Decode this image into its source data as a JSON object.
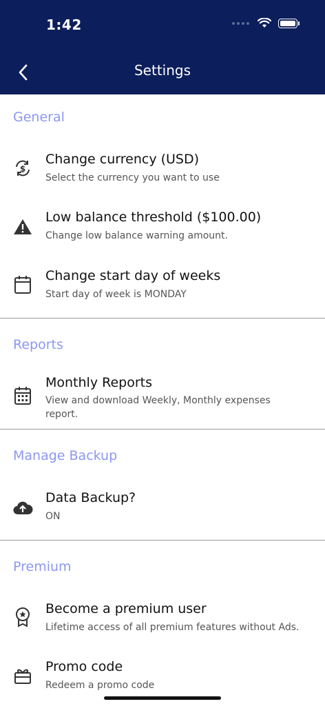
{
  "status_bar": {
    "time": "1:42"
  },
  "header": {
    "title": "Settings"
  },
  "sections": {
    "general": {
      "label": "General",
      "items": [
        {
          "title": "Change currency (USD)",
          "subtitle": "Select the currency you want to use",
          "icon": "currency-exchange-icon"
        },
        {
          "title": "Low balance threshold ($100.00)",
          "subtitle": "Change low balance warning amount.",
          "icon": "warning-icon"
        },
        {
          "title": "Change start day of weeks",
          "subtitle": "Start day of week is MONDAY",
          "icon": "calendar-icon"
        }
      ]
    },
    "reports": {
      "label": "Reports",
      "items": [
        {
          "title": "Monthly Reports",
          "subtitle": "View and download Weekly, Monthly expenses report.",
          "icon": "calendar-grid-icon"
        }
      ]
    },
    "backup": {
      "label": "Manage Backup",
      "items": [
        {
          "title": "Data Backup?",
          "subtitle": "ON",
          "icon": "cloud-upload-icon"
        }
      ]
    },
    "premium": {
      "label": "Premium",
      "items": [
        {
          "title": "Become a premium user",
          "subtitle": "Lifetime access of all premium features without Ads.",
          "icon": "award-icon"
        },
        {
          "title": "Promo code",
          "subtitle": "Redeem a promo code",
          "icon": "gift-icon"
        }
      ]
    }
  },
  "colors": {
    "header_bg": "#0c1e5b",
    "section_label": "#8c97f2"
  }
}
